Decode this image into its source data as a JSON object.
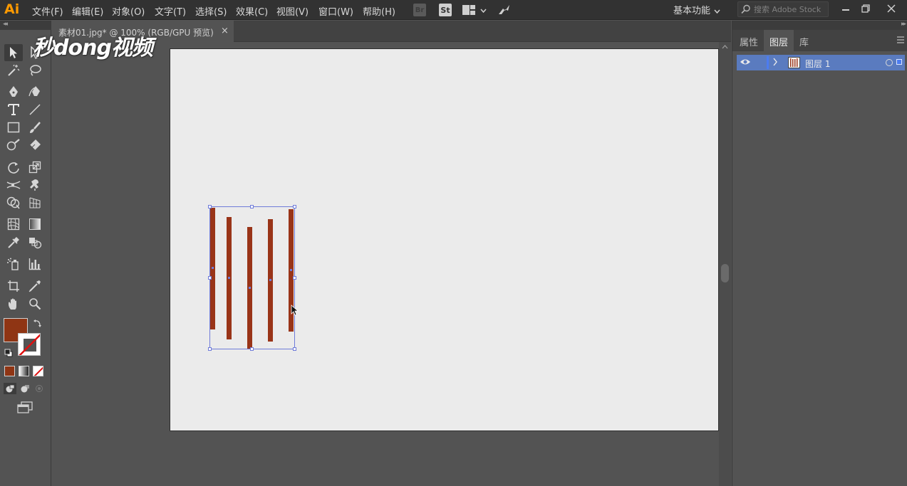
{
  "app": {
    "logo": "Ai"
  },
  "menu": [
    {
      "label": "文件(F)"
    },
    {
      "label": "编辑(E)"
    },
    {
      "label": "对象(O)"
    },
    {
      "label": "文字(T)"
    },
    {
      "label": "选择(S)"
    },
    {
      "label": "效果(C)"
    },
    {
      "label": "视图(V)"
    },
    {
      "label": "窗口(W)"
    },
    {
      "label": "帮助(H)"
    }
  ],
  "top_icons": {
    "bridge": "Br",
    "stock": "St"
  },
  "workspace": {
    "label": "基本功能"
  },
  "search": {
    "placeholder": "搜索 Adobe Stock"
  },
  "document_tab": {
    "title": "素材01.jpg* @ 100% (RGB/GPU 预览)",
    "close": "×"
  },
  "watermark": {
    "text": "秒dong视频"
  },
  "right_panel": {
    "tabs": [
      "属性",
      "图层",
      "库"
    ],
    "active_tab": "图层",
    "layers": [
      {
        "name": "图层 1"
      }
    ]
  },
  "colors": {
    "fill": "#8f3514",
    "stripe": "#993418",
    "selection": "#6f7bd9",
    "accent": "#4c7cf0",
    "app_logo": "#ff9a00"
  },
  "tools": [
    "selection-tool",
    "direct-selection-tool",
    "magic-wand-tool",
    "lasso-tool",
    "pen-tool",
    "curvature-tool",
    "type-tool",
    "line-segment-tool",
    "rectangle-tool",
    "paintbrush-tool",
    "shaper-tool",
    "eraser-tool",
    "rotate-tool",
    "scale-tool",
    "width-tool",
    "puppet-warp-tool",
    "shape-builder-tool",
    "perspective-grid-tool",
    "mesh-tool",
    "gradient-tool",
    "eyedropper-tool",
    "blend-tool",
    "symbol-sprayer-tool",
    "column-graph-tool",
    "artboard-tool",
    "slice-tool",
    "hand-tool",
    "zoom-tool"
  ]
}
